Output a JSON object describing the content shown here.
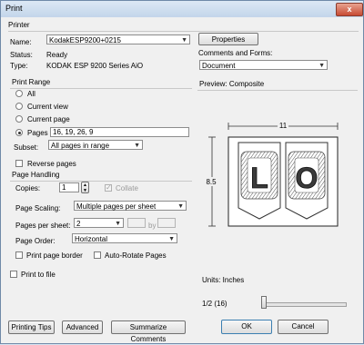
{
  "window": {
    "title": "Print",
    "close_glyph": "x"
  },
  "printer": {
    "section_label": "Printer",
    "name_label": "Name:",
    "name_value": "KodakESP9200+0215",
    "properties_label": "Properties",
    "status_label": "Status:",
    "status_value": "Ready",
    "type_label": "Type:",
    "type_value": "KODAK ESP 9200 Series AiO",
    "comments_label": "Comments and Forms:",
    "comments_value": "Document"
  },
  "print_range": {
    "section_label": "Print Range",
    "all_label": "All",
    "current_view_label": "Current view",
    "current_page_label": "Current page",
    "pages_label": "Pages",
    "pages_value": "16, 19, 26, 9",
    "subset_label": "Subset:",
    "subset_value": "All pages in range",
    "reverse_label": "Reverse pages"
  },
  "page_handling": {
    "section_label": "Page Handling",
    "copies_label": "Copies:",
    "copies_value": "1",
    "collate_label": "Collate",
    "scaling_label": "Page Scaling:",
    "scaling_value": "Multiple pages per sheet",
    "per_sheet_label": "Pages per sheet:",
    "per_sheet_value": "2",
    "by_label": "by",
    "order_label": "Page Order:",
    "order_value": "Horizontal",
    "border_label": "Print page border",
    "autorotate_label": "Auto-Rotate Pages"
  },
  "print_to_file_label": "Print to file",
  "preview": {
    "label": "Preview: Composite",
    "width_dim": "11",
    "height_dim": "8.5",
    "page1_letter": "L",
    "page2_letter": "O",
    "units": "Units: Inches",
    "page_indicator": "1/2 (16)",
    "slider_value": 0
  },
  "buttons": {
    "printing_tips": "Printing Tips",
    "advanced": "Advanced",
    "summarize": "Summarize Comments",
    "ok": "OK",
    "cancel": "Cancel"
  }
}
